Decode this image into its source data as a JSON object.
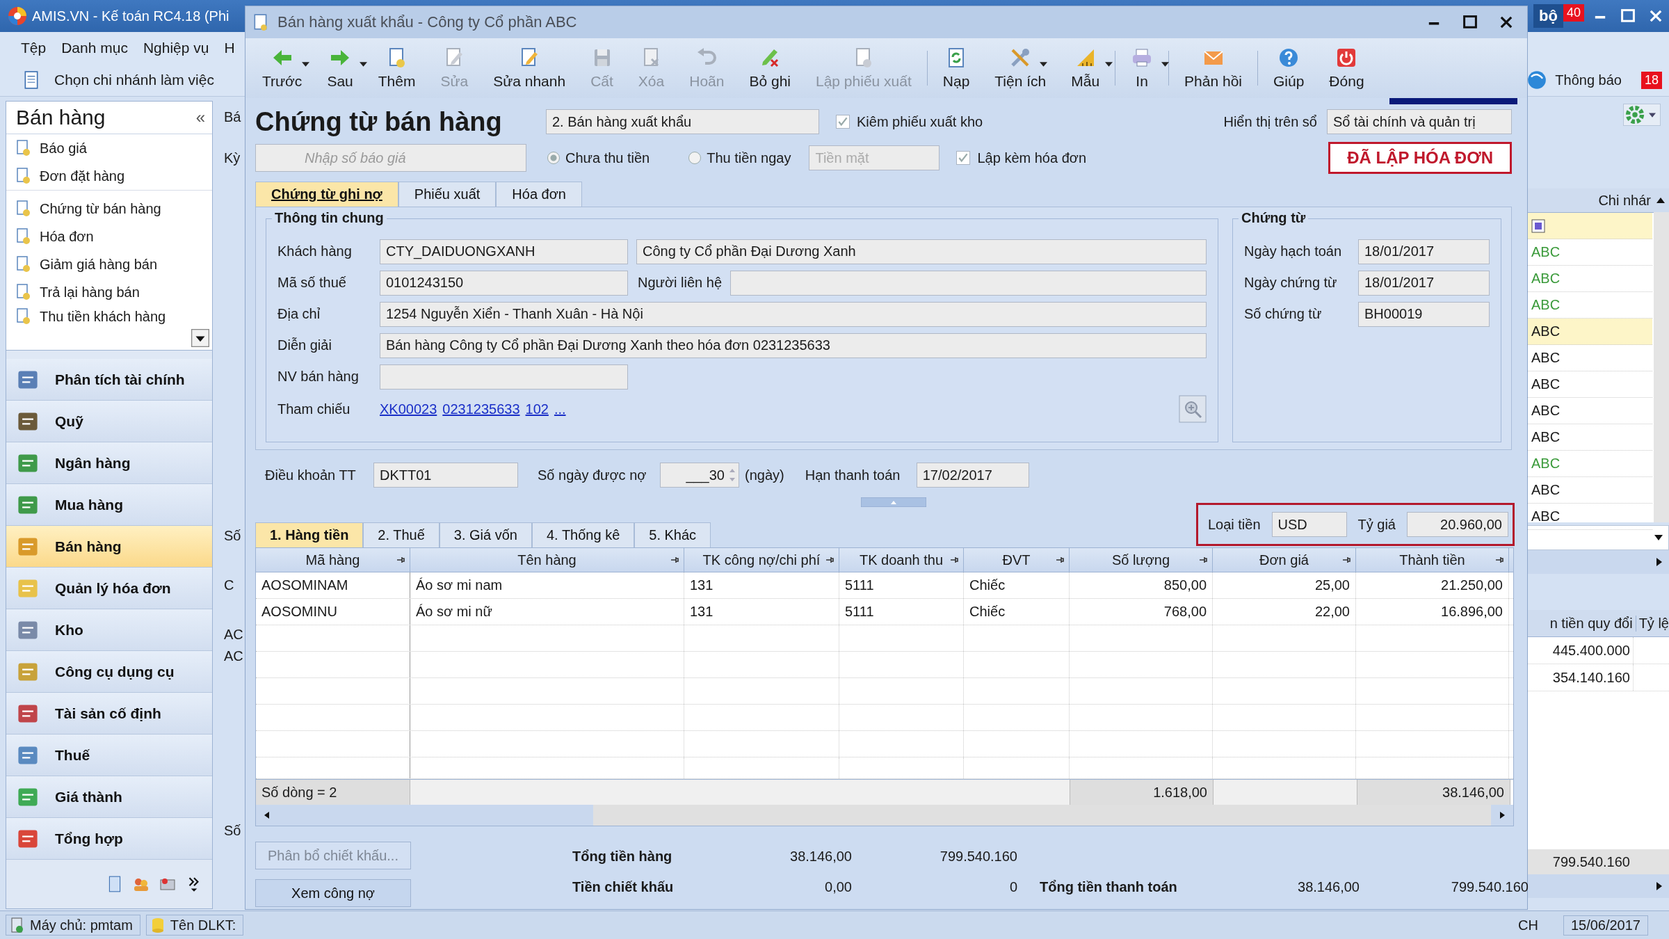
{
  "main_window": {
    "title": "AMIS.VN - Kế toán RC4.18 (Phi",
    "badge_text": "bộ",
    "badge_count": "40"
  },
  "menu": [
    "Tệp",
    "Danh mục",
    "Nghiệp vụ",
    "H"
  ],
  "main_toolbar": {
    "branch": "Chọn chi nhánh làm việc",
    "notifications": "Thông báo",
    "notification_count": "18"
  },
  "sidebar": {
    "title": "Bán hàng",
    "collapse": "«",
    "items": [
      {
        "label": "Báo giá"
      },
      {
        "label": "Đơn đặt hàng"
      },
      {
        "label": "Chứng từ bán hàng"
      },
      {
        "label": "Hóa đơn"
      },
      {
        "label": "Giảm giá hàng bán"
      },
      {
        "label": "Trả lại hàng bán"
      },
      {
        "label": "Thu tiền khách hàng"
      }
    ],
    "modules": [
      {
        "label": "Phân tích tài chính",
        "selected": false
      },
      {
        "label": "Quỹ",
        "selected": false
      },
      {
        "label": "Ngân hàng",
        "selected": false
      },
      {
        "label": "Mua hàng",
        "selected": false
      },
      {
        "label": "Bán hàng",
        "selected": true
      },
      {
        "label": "Quản lý hóa đơn",
        "selected": false
      },
      {
        "label": "Kho",
        "selected": false
      },
      {
        "label": "Công cụ dụng cụ",
        "selected": false
      },
      {
        "label": "Tài sản cố định",
        "selected": false
      },
      {
        "label": "Thuế",
        "selected": false
      },
      {
        "label": "Giá thành",
        "selected": false
      },
      {
        "label": "Tổng hợp",
        "selected": false
      }
    ]
  },
  "middle_strip": [
    "Bá",
    "Kỳ",
    "Số",
    "C",
    "AC",
    "AC",
    "Số"
  ],
  "right_panel": {
    "column": "Chi nhár",
    "rows": [
      {
        "text": "ABC",
        "color": "#3a9a3a",
        "selected": false
      },
      {
        "text": "ABC",
        "color": "#3a9a3a",
        "selected": false
      },
      {
        "text": "ABC",
        "color": "#3a9a3a",
        "selected": false
      },
      {
        "text": "ABC",
        "color": "#1a1a1a",
        "selected": true
      },
      {
        "text": "ABC",
        "color": "#1a1a1a",
        "selected": false
      },
      {
        "text": "ABC",
        "color": "#1a1a1a",
        "selected": false
      },
      {
        "text": "ABC",
        "color": "#1a1a1a",
        "selected": false
      },
      {
        "text": "ABC",
        "color": "#1a1a1a",
        "selected": false
      },
      {
        "text": "ABC",
        "color": "#3a9a3a",
        "selected": false
      },
      {
        "text": "ABC",
        "color": "#1a1a1a",
        "selected": false
      },
      {
        "text": "ABC",
        "color": "#1a1a1a",
        "selected": false
      }
    ],
    "lower_columns": [
      "n tiền quy đổi",
      "Tỷ lệ"
    ],
    "lower_values": [
      "445.400.000",
      "354.140.160"
    ],
    "lower_total": "799.540.160"
  },
  "status_bar": {
    "server": "Máy chủ: pmtam",
    "database": "Tên DLKT:",
    "language": "CH",
    "date": "15/06/2017"
  },
  "dialog": {
    "title": "Bán hàng xuất khẩu - Công ty Cổ phần ABC",
    "toolbar": [
      {
        "label": "Trước",
        "disabled": false,
        "dropdown": true
      },
      {
        "label": "Sau",
        "disabled": false,
        "dropdown": true
      },
      {
        "label": "Thêm",
        "disabled": false,
        "dropdown": false
      },
      {
        "label": "Sửa",
        "disabled": true,
        "dropdown": false
      },
      {
        "label": "Sửa nhanh",
        "disabled": false,
        "dropdown": false
      },
      {
        "label": "Cất",
        "disabled": true,
        "dropdown": false
      },
      {
        "label": "Xóa",
        "disabled": true,
        "dropdown": false
      },
      {
        "label": "Hoãn",
        "disabled": true,
        "dropdown": false
      },
      {
        "label": "Bỏ ghi",
        "disabled": false,
        "dropdown": false
      },
      {
        "label": "Lập phiếu xuất",
        "disabled": true,
        "dropdown": false
      },
      {
        "label": "Nạp",
        "disabled": false,
        "dropdown": false
      },
      {
        "label": "Tiện ích",
        "disabled": false,
        "dropdown": true
      },
      {
        "label": "Mẫu",
        "disabled": false,
        "dropdown": true
      },
      {
        "label": "In",
        "disabled": false,
        "dropdown": true
      },
      {
        "label": "Phản hồi",
        "disabled": false,
        "dropdown": false
      },
      {
        "label": "Giúp",
        "disabled": false,
        "dropdown": false
      },
      {
        "label": "Đóng",
        "disabled": false,
        "dropdown": false
      }
    ],
    "heading": "Chứng từ bán hàng",
    "voucher_type": "2. Bán hàng xuất khẩu",
    "export_slip": {
      "label": "Kiêm phiếu xuất kho",
      "checked": true
    },
    "ledger": {
      "label": "Hiển thị trên sổ",
      "value": "Sổ tài chính và quản trị"
    },
    "quote_field": {
      "placeholder": "Nhập số báo giá"
    },
    "payment": [
      {
        "label": "Chưa thu tiền",
        "selected": true
      },
      {
        "label": "Thu tiền ngay",
        "selected": false
      }
    ],
    "payment_method": {
      "placeholder": "Tiền mặt"
    },
    "invoice_attached": {
      "label": "Lập kèm hóa đơn",
      "checked": true
    },
    "stamp": "ĐÃ LẬP HÓA ĐƠN",
    "tabs": [
      {
        "label": "Chứng từ ghi nợ",
        "selected": true
      },
      {
        "label": "Phiếu xuất",
        "selected": false
      },
      {
        "label": "Hóa đơn",
        "selected": false
      }
    ],
    "general": {
      "title": "Thông tin chung",
      "customer_label": "Khách hàng",
      "customer_code": "CTY_DAIDUONGXANH",
      "customer_name": "Công ty Cổ phần Đại Dương Xanh",
      "tax_label": "Mã số thuế",
      "tax_code": "0101243150",
      "contact_label": "Người liên hệ",
      "address_label": "Địa chỉ",
      "address": "1254 Nguyễn Xiển - Thanh Xuân - Hà Nội",
      "description_label": "Diễn giải",
      "description": "Bán hàng Công ty Cổ phần Đại Dương Xanh theo hóa đơn 0231235633",
      "salesperson_label": "NV bán hàng",
      "reference_label": "Tham chiếu",
      "references": [
        "XK00023",
        "0231235633",
        "102",
        "..."
      ]
    },
    "voucher": {
      "title": "Chứng từ",
      "fields": [
        {
          "label": "Ngày hạch toán",
          "value": "18/01/2017"
        },
        {
          "label": "Ngày chứng từ",
          "value": "18/01/2017"
        },
        {
          "label": "Số chứng từ",
          "value": "BH00019"
        }
      ]
    },
    "terms": {
      "label": "Điều khoản TT",
      "value": "DKTT01",
      "days_label": "Số ngày được nợ",
      "days": "___30",
      "days_unit": "(ngày)",
      "due_label": "Hạn thanh toán",
      "due": "17/02/2017"
    },
    "currency": {
      "label": "Loại tiền",
      "value": "USD",
      "rate_label": "Tỷ giá",
      "rate": "20.960,00"
    },
    "detail_tabs": [
      {
        "label": "1. Hàng tiền",
        "selected": true
      },
      {
        "label": "2. Thuế",
        "selected": false
      },
      {
        "label": "3. Giá vốn",
        "selected": false
      },
      {
        "label": "4. Thống kê",
        "selected": false
      },
      {
        "label": "5. Khác",
        "selected": false
      }
    ],
    "table": {
      "columns": [
        {
          "label": "Mã hàng"
        },
        {
          "label": "Tên hàng"
        },
        {
          "label": "TK công nợ/chi phí"
        },
        {
          "label": "TK doanh thu"
        },
        {
          "label": "ĐVT"
        },
        {
          "label": "Số lượng"
        },
        {
          "label": "Đơn giá"
        },
        {
          "label": "Thành tiền"
        }
      ],
      "rows": [
        [
          "AOSOMINAM",
          "Áo sơ mi nam",
          "131",
          "5111",
          "Chiếc",
          "850,00",
          "25,00",
          "21.250,00"
        ],
        [
          "AOSOMINU",
          "Áo sơ mi nữ",
          "131",
          "5111",
          "Chiếc",
          "768,00",
          "22,00",
          "16.896,00"
        ]
      ],
      "footer": {
        "count": "Số dòng = 2",
        "quantity": "1.618,00",
        "amount": "38.146,00"
      }
    },
    "buttons": [
      {
        "label": "Phân bổ chiết khấu...",
        "disabled": true
      },
      {
        "label": "Xem công nợ",
        "disabled": false
      }
    ],
    "totals": [
      {
        "label": "Tổng tiền hàng",
        "amount": "38.146,00",
        "converted": "799.540.160"
      },
      {
        "label": "Tiền chiết khấu",
        "amount": "0,00",
        "converted": "0"
      }
    ],
    "grand_total": {
      "label": "Tổng tiền thanh toán",
      "amount": "38.146,00",
      "converted": "799.540.160"
    }
  }
}
